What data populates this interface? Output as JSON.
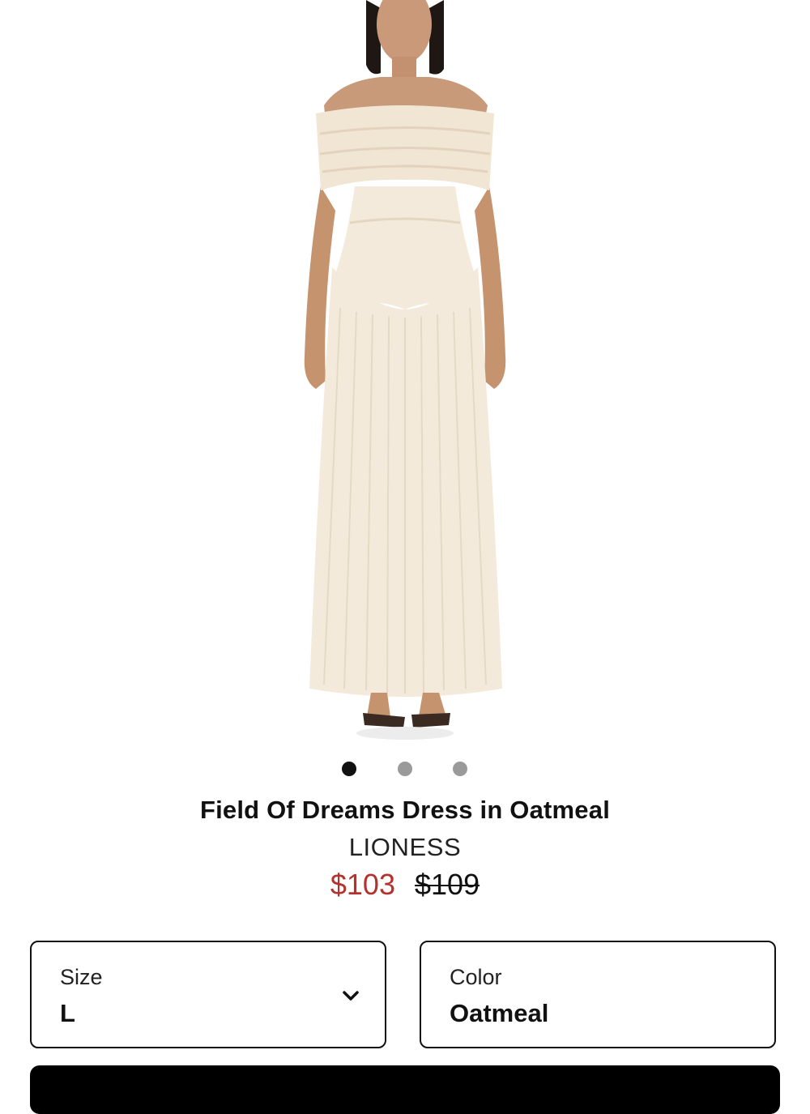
{
  "product": {
    "image_alt": "Model wearing off-shoulder pleated maxi dress in oatmeal",
    "title": "Field Of Dreams Dress in Oatmeal",
    "brand": "LIONESS",
    "sale_price": "$103",
    "original_price": "$109"
  },
  "carousel": {
    "total_slides": 3,
    "active_slide": 1
  },
  "options": {
    "size": {
      "label": "Size",
      "value": "L",
      "icon": "chevron-down-icon"
    },
    "color": {
      "label": "Color",
      "value": "Oatmeal"
    }
  },
  "colors": {
    "sale_price": "#b4322e",
    "dress": "#f3ead9",
    "button": "#000000",
    "dot_active": "#111111",
    "dot_inactive": "#9a9a9a"
  }
}
